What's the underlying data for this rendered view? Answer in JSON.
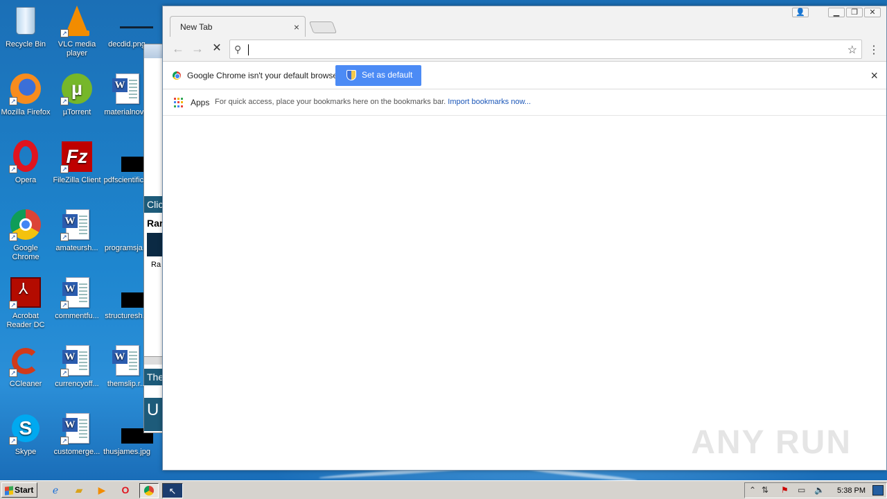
{
  "desktop": {
    "icons": [
      {
        "label": "Recycle Bin",
        "icon": "recycle-bin-icon"
      },
      {
        "label": "VLC media player",
        "icon": "vlc-icon"
      },
      {
        "label": "decdid.png",
        "icon": "image-file-icon"
      },
      {
        "label": "Mozilla Firefox",
        "icon": "firefox-icon"
      },
      {
        "label": "µTorrent",
        "icon": "utorrent-icon"
      },
      {
        "label": "materialnov...",
        "icon": "word-document-icon"
      },
      {
        "label": "Opera",
        "icon": "opera-icon"
      },
      {
        "label": "FileZilla Client",
        "icon": "filezilla-icon"
      },
      {
        "label": "pdfscientific...",
        "icon": "image-file-icon"
      },
      {
        "label": "Google Chrome",
        "icon": "chrome-icon"
      },
      {
        "label": "amateursh...",
        "icon": "word-document-icon"
      },
      {
        "label": "programsja...",
        "icon": "image-file-icon"
      },
      {
        "label": "Acrobat Reader DC",
        "icon": "acrobat-icon"
      },
      {
        "label": "commentfu...",
        "icon": "word-document-icon"
      },
      {
        "label": "structuresh...",
        "icon": "image-file-icon"
      },
      {
        "label": "CCleaner",
        "icon": "ccleaner-icon"
      },
      {
        "label": "currencyoff...",
        "icon": "word-document-icon"
      },
      {
        "label": "themslip.r...",
        "icon": "word-document-icon"
      },
      {
        "label": "Skype",
        "icon": "skype-icon"
      },
      {
        "label": "customerge...",
        "icon": "word-document-icon"
      },
      {
        "label": "thusjames.jpg",
        "icon": "image-file-icon"
      }
    ],
    "bg_window": {
      "text1": "Clic",
      "text2": "Rar",
      "text3": "Ra",
      "text4": "The",
      "text5": "U"
    }
  },
  "chrome": {
    "tab_title": "New Tab",
    "tab_close": "×",
    "omnibox": {
      "value": "",
      "placeholder": ""
    },
    "infobar": {
      "message": "Google Chrome isn't your default browser.",
      "button": "Set as default",
      "close": "×"
    },
    "bookmarks": {
      "apps": "Apps",
      "hint": "For quick access, place your bookmarks here on the bookmarks bar.",
      "import_link": "Import bookmarks now..."
    },
    "watermark": "ANY RUN"
  },
  "taskbar": {
    "start": "Start",
    "clock": "5:38 PM"
  },
  "colors": {
    "accent": "#4c8bf5",
    "desktop_bg": "#1e86cf",
    "taskbar_bg": "#d6d3ce"
  }
}
